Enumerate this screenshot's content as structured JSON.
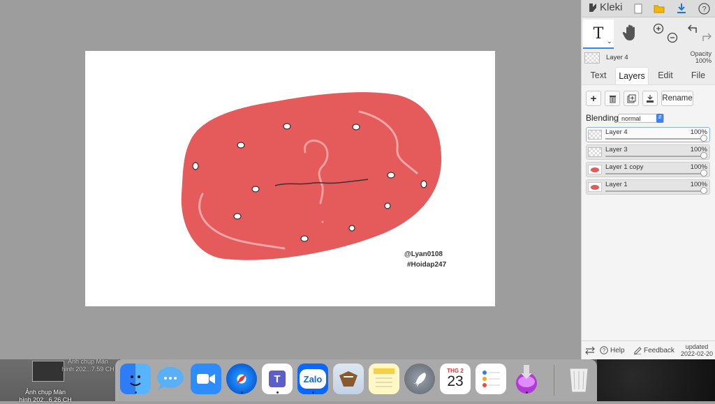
{
  "app": {
    "name": "Kleki"
  },
  "canvas": {
    "signature_line1": "@Lyan0108",
    "signature_line2": "#Hoidap247",
    "colors": {
      "blob": "#e55a5b",
      "stroke": "#f4a7a7",
      "line": "#333333"
    }
  },
  "toolbar": {
    "text_tool_label": "T",
    "icons": [
      "text-tool-icon",
      "hand-tool-icon",
      "zoom-in-icon",
      "zoom-out-icon",
      "undo-icon",
      "redo-icon"
    ]
  },
  "current_layer": {
    "name": "Layer 4",
    "opacity_label": "Opacity",
    "opacity_value": "100%"
  },
  "tabs": [
    {
      "label": "Text"
    },
    {
      "label": "Layers"
    },
    {
      "label": "Edit"
    },
    {
      "label": "File"
    }
  ],
  "layer_actions": {
    "rename_label": "Rename"
  },
  "blending": {
    "label": "Blending",
    "value": "normal"
  },
  "layers": [
    {
      "name": "Layer 4",
      "opacity": "100%"
    },
    {
      "name": "Layer 3",
      "opacity": "100%"
    },
    {
      "name": "Layer 1 copy",
      "opacity": "100%"
    },
    {
      "name": "Layer 1",
      "opacity": "100%"
    }
  ],
  "footer": {
    "help_label": "Help",
    "feedback_label": "Feedback",
    "updated_label": "updated",
    "updated_date": "2022-02-20"
  },
  "desktop": {
    "file1_line1": "Ảnh chụp Màn",
    "file1_line2": "hình 202...7.59 CH",
    "file2_line1": "Ảnh chụp Màn",
    "file2_line2": "hình 202...6.26 CH"
  },
  "dock": {
    "apps": [
      "Finder",
      "Messages",
      "Zoom",
      "Safari",
      "Teams",
      "Zalo",
      "Mail",
      "Notes",
      "Launchpad",
      "Calendar",
      "Reminders",
      "Installer",
      "Trash"
    ],
    "calendar_month": "THG 2",
    "calendar_day": "23",
    "zalo_label": "Zalo",
    "teams_label": "T"
  }
}
